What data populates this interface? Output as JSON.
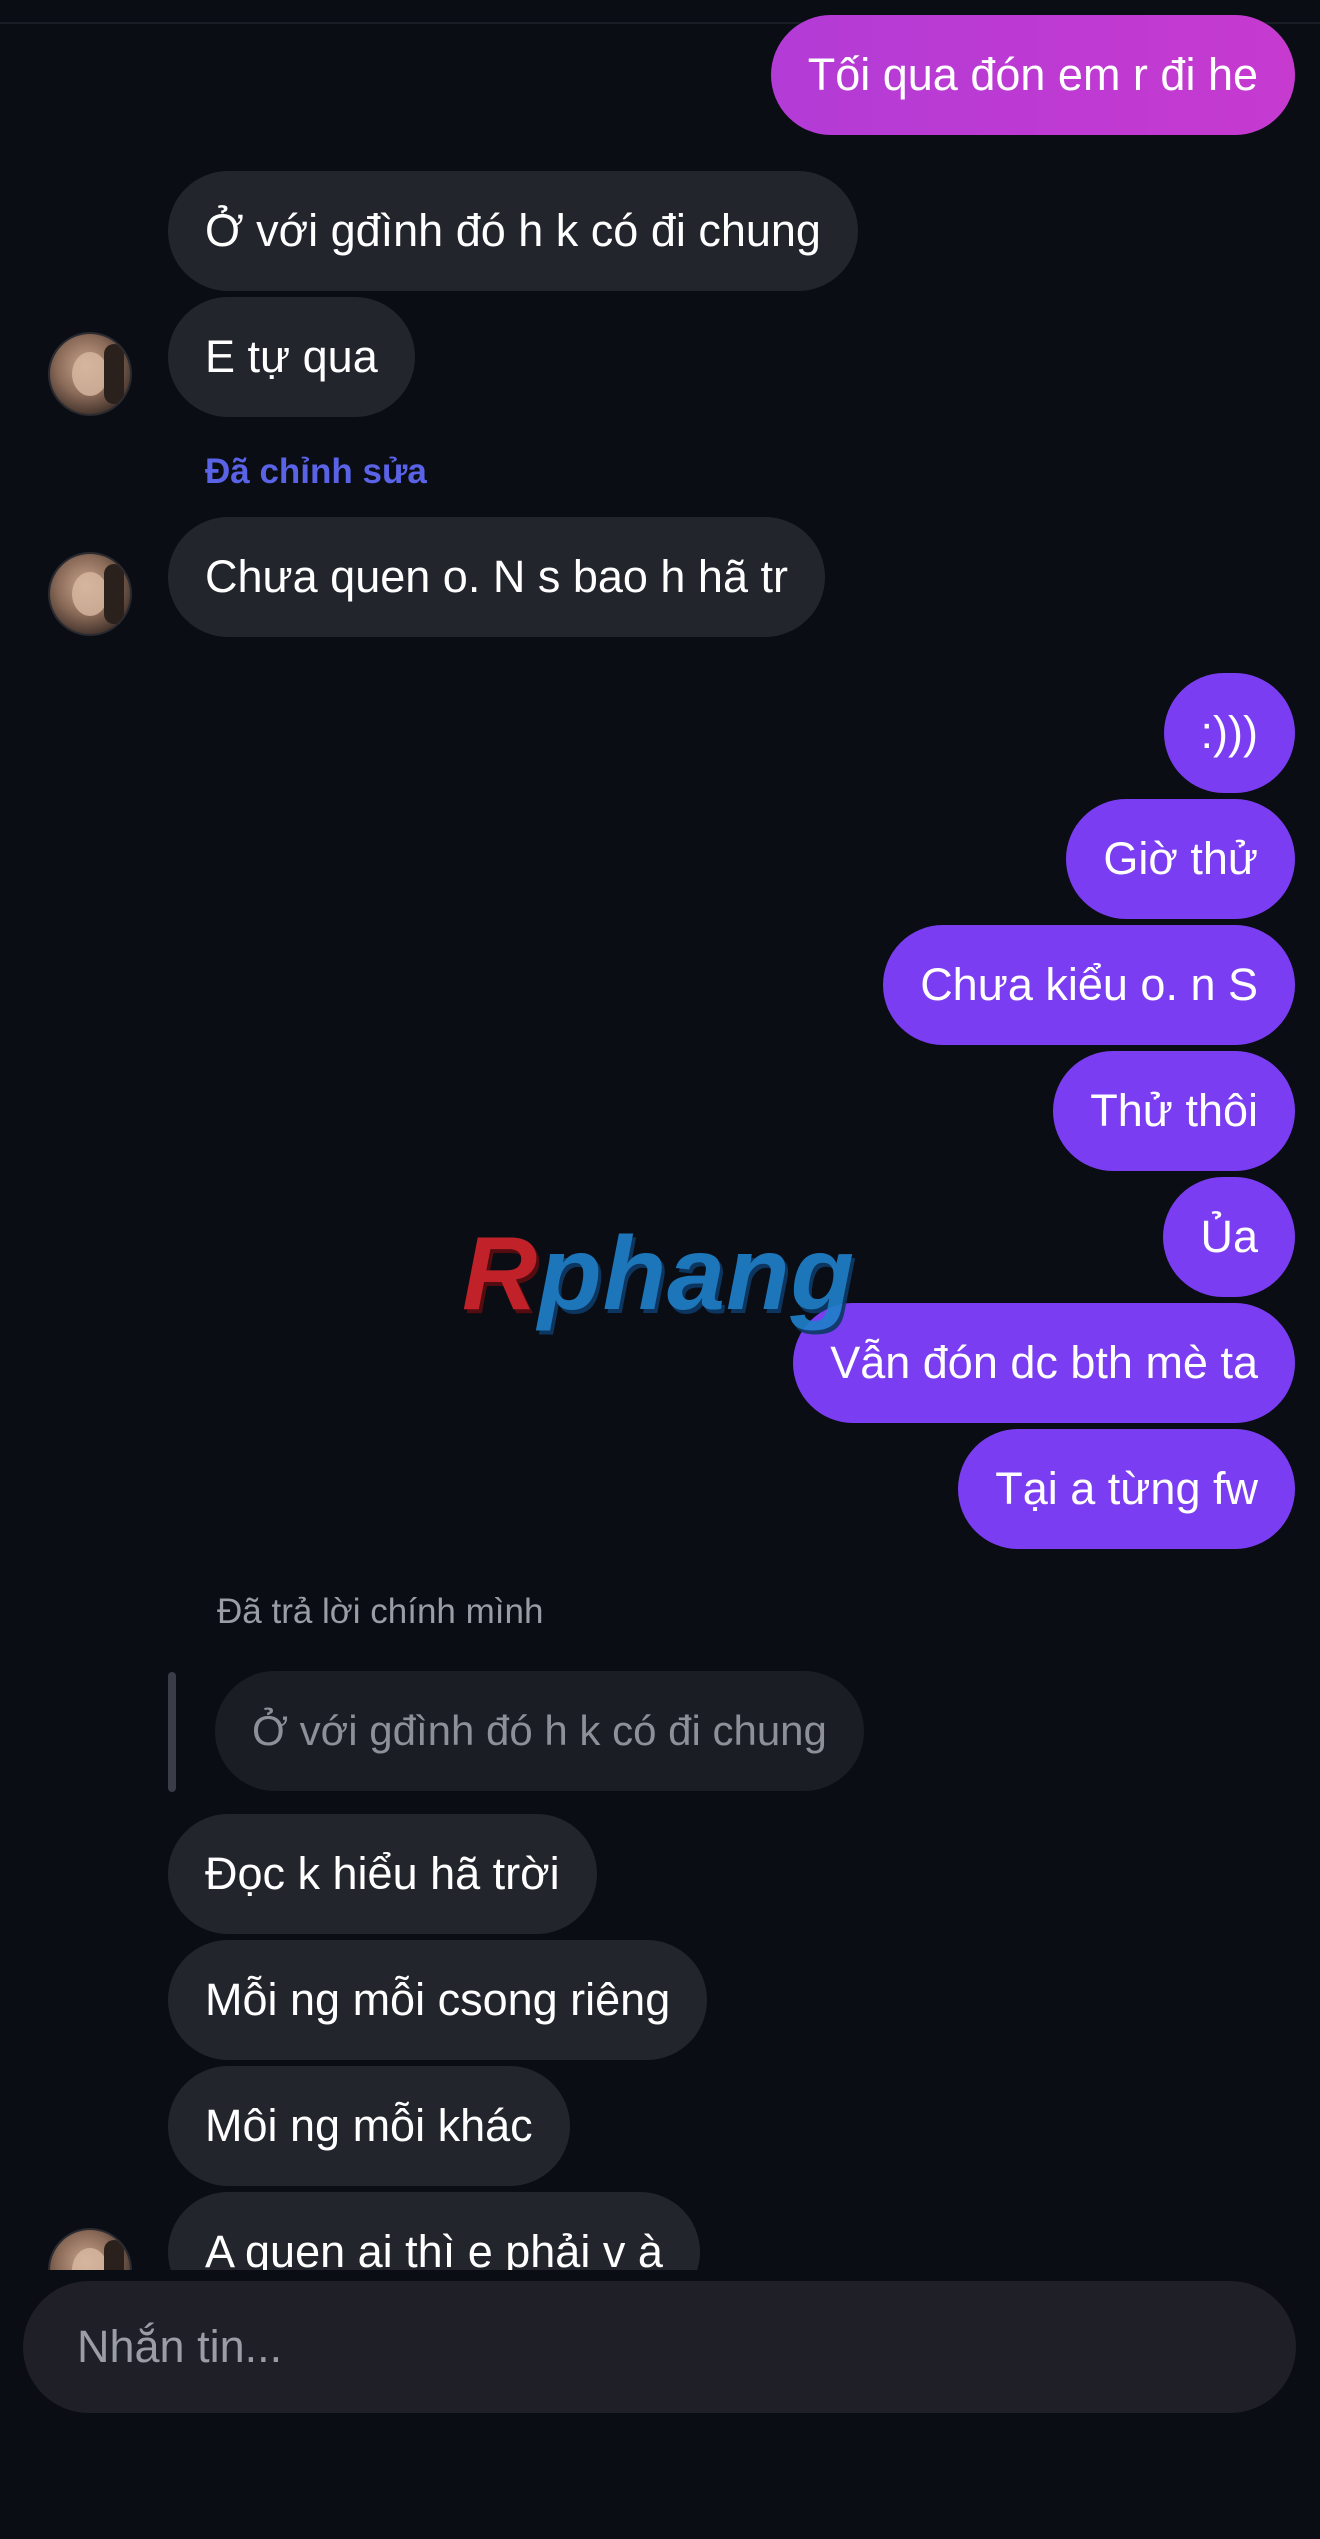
{
  "messages": {
    "m0": "Tối qua đón em r đi he",
    "m1": "Ở với gđình đó h k có đi chung",
    "m2": "E tự qua",
    "edited_label": "Đã chỉnh sửa",
    "m3": "Chưa quen o. N s bao h hã tr",
    "m4": ":)))",
    "m5": "Giờ thử",
    "m6": "Chưa kiểu o. n S",
    "m7": "Thử thôi",
    "m8": "Ủa",
    "m9": "Vẫn đón dc bth mè ta",
    "m10": "Tại a từng fw",
    "reply_label": "Đã trả lời chính mình",
    "quoted": "Ở với gđình đó h k có đi chung",
    "m11": "Đọc k hiểu hã trời",
    "m12": "Mỗi ng mỗi csong riêng",
    "m13": "Môi ng mỗi khác",
    "m14": "A quen ai thì e phải v à"
  },
  "watermark": {
    "first": "R",
    "rest": "phang"
  },
  "composer": {
    "placeholder": "Nhắn tin..."
  },
  "colors": {
    "background": "#0b0d14",
    "incoming_bubble": "#23252d",
    "outgoing_bubble": "#7b3df2",
    "outgoing_gradient": "#c03ad3",
    "edited_label": "#5a63e6"
  }
}
